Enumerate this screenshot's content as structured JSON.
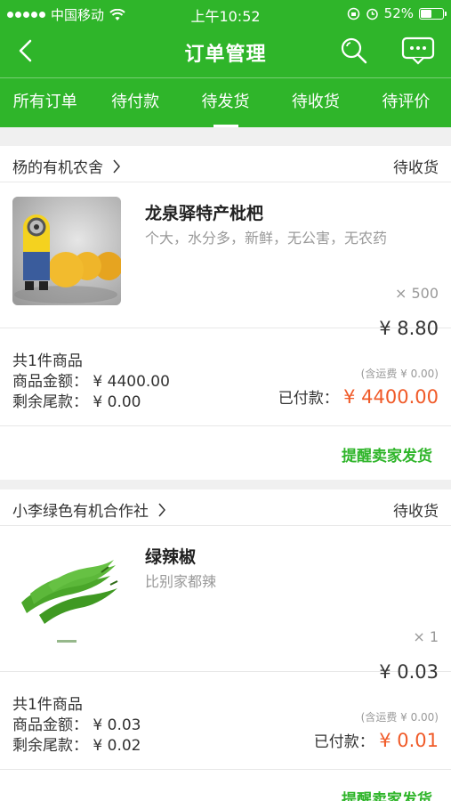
{
  "status_bar": {
    "carrier": "中国移动",
    "time": "上午10:52",
    "battery": "52%",
    "battery_level": 0.52
  },
  "navbar": {
    "title": "订单管理"
  },
  "tabs": [
    {
      "label": "所有订单"
    },
    {
      "label": "待付款"
    },
    {
      "label": "待发货"
    },
    {
      "label": "待收货"
    },
    {
      "label": "待评价"
    }
  ],
  "orders": [
    {
      "shop": "杨的有机农舍",
      "status": "待收货",
      "product_name": "龙泉驿特产枇杷",
      "product_desc": "个大，水分多，新鲜，无公害，无农药",
      "qty": "× 500",
      "price": "¥ 8.80",
      "count": "共1件商品",
      "goods_amount": "商品金额：  ¥ 4400.00",
      "balance": "剩余尾款：  ¥ 0.00",
      "freight": "(含运费 ¥ 0.00)",
      "paid_label": "已付款：",
      "paid_amount": "¥ 4400.00",
      "action": "提醒卖家发货"
    },
    {
      "shop": "小李绿色有机合作社",
      "status": "待收货",
      "product_name": "绿辣椒",
      "product_desc": "比别家都辣",
      "qty": "× 1",
      "price": "¥ 0.03",
      "count": "共1件商品",
      "goods_amount": "商品金额：  ¥ 0.03",
      "balance": "剩余尾款：  ¥ 0.02",
      "freight": "(含运费 ¥ 0.00)",
      "paid_label": "已付款：",
      "paid_amount": "¥ 0.01",
      "action": "提醒卖家发货"
    }
  ],
  "colors": {
    "brand": "#2fb52a",
    "price_accent": "#f05a28"
  }
}
